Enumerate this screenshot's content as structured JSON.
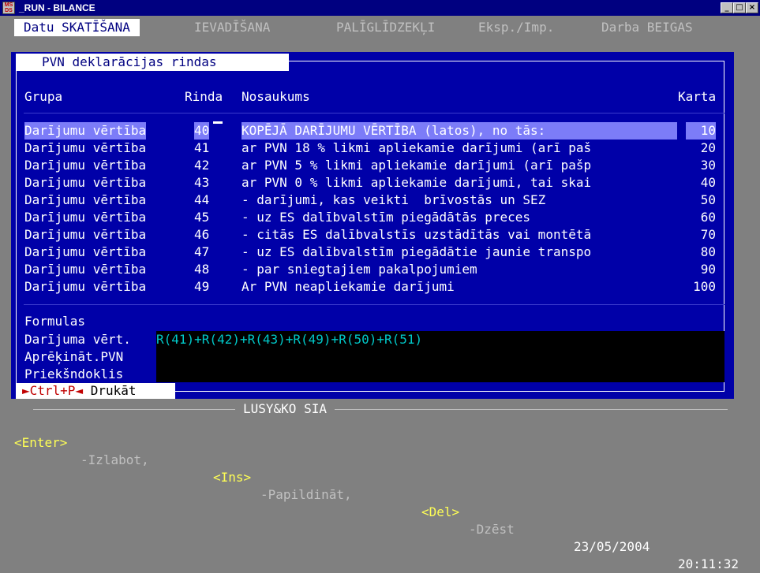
{
  "window": {
    "title": "_RUN - BILANCE",
    "icon_text": "MS\nDS",
    "buttons": [
      "_",
      "□",
      "×"
    ]
  },
  "menu": [
    {
      "label": "Datu SKATĪŠANA",
      "active": true
    },
    {
      "label": "IEVADĪŠANA",
      "active": false
    },
    {
      "label": "PALĪGLĪDZEKĻI",
      "active": false
    },
    {
      "label": "Eksp./Imp.",
      "active": false
    },
    {
      "label": "Darba BEIGAS",
      "active": false
    }
  ],
  "dialog": {
    "title": "PVN deklarācijas rindas",
    "columns": {
      "grupa": "Grupa",
      "rinda": "Rinda",
      "nosaukums": "Nosaukums",
      "karta": "Karta"
    },
    "rows": [
      {
        "grupa": "Darījumu vērtība",
        "rinda": "40",
        "nosaukums": "KOPĒJĀ DARĪJUMU VĒRTĪBA (latos), no tās:",
        "karta": "10",
        "selected": true
      },
      {
        "grupa": "Darījumu vērtība",
        "rinda": "41",
        "nosaukums": "ar PVN 18 % likmi apliekamie darījumi (arī paš",
        "karta": "20"
      },
      {
        "grupa": "Darījumu vērtība",
        "rinda": "42",
        "nosaukums": "ar PVN 5 % likmi apliekamie darījumi (arī pašp",
        "karta": "30"
      },
      {
        "grupa": "Darījumu vērtība",
        "rinda": "43",
        "nosaukums": "ar PVN 0 % likmi apliekamie darījumi, tai skai",
        "karta": "40"
      },
      {
        "grupa": "Darījumu vērtība",
        "rinda": "44",
        "nosaukums": "- darījumi, kas veikti  brīvostās un SEZ",
        "karta": "50"
      },
      {
        "grupa": "Darījumu vērtība",
        "rinda": "45",
        "nosaukums": "- uz ES dalībvalstīm piegādātās preces",
        "karta": "60"
      },
      {
        "grupa": "Darījumu vērtība",
        "rinda": "46",
        "nosaukums": "- citās ES dalībvalstīs uzstādītās vai montētā",
        "karta": "70"
      },
      {
        "grupa": "Darījumu vērtība",
        "rinda": "47",
        "nosaukums": "- uz ES dalībvalstīm piegādātie jaunie transpo",
        "karta": "80"
      },
      {
        "grupa": "Darījumu vērtība",
        "rinda": "48",
        "nosaukums": "- par sniegtajiem pakalpojumiem",
        "karta": "90"
      },
      {
        "grupa": "Darījumu vērtība",
        "rinda": "49",
        "nosaukums": "Ar PVN neapliekamie darījumi",
        "karta": "100"
      }
    ],
    "formulas_label": "Formulas",
    "fields": [
      {
        "label": "Darījuma vērt.",
        "value": "R(41)+R(42)+R(43)+R(49)+R(50)+R(51)"
      },
      {
        "label": "Aprēķināt.PVN",
        "value": ""
      },
      {
        "label": "Priekšndoklis",
        "value": ""
      }
    ],
    "print_hint": {
      "left_arrow": "►",
      "key": "Ctrl+P",
      "right_arrow": "◄",
      "action": " Drukāt"
    }
  },
  "footer": {
    "company": "LUSY&KO SIA",
    "keys": [
      {
        "key": "<Enter>",
        "action": "-Izlabot,"
      },
      {
        "key": "<Ins>",
        "action": "-Papildināt,"
      },
      {
        "key": "<Del>",
        "action": "-Dzēst"
      }
    ],
    "date": "23/05/2004",
    "time": "20:11:32"
  }
}
